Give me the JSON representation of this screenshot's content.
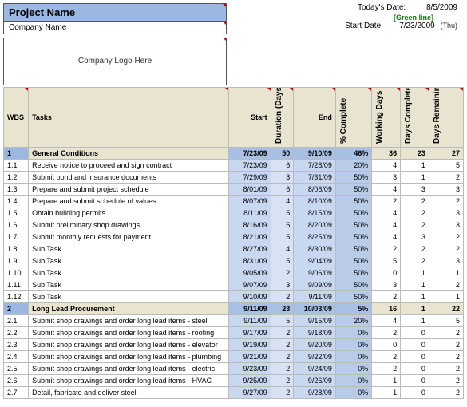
{
  "header": {
    "project_name": "Project Name",
    "company_name": "Company Name",
    "logo_placeholder": "Company Logo Here",
    "todays_date_label": "Today's Date:",
    "todays_date": "8/5/2009",
    "green_line": "[Green line]",
    "start_date_label": "Start Date:",
    "start_date": "7/23/2009",
    "start_day": "(Thu)"
  },
  "columns": {
    "wbs": "WBS",
    "tasks": "Tasks",
    "start": "Start",
    "duration": "Duration (Days)",
    "end": "End",
    "pct": "% Complete",
    "working": "Working Days",
    "days_complete": "Days Complete",
    "days_remaining": "Days Remaining"
  },
  "rows": [
    {
      "wbs": "1",
      "task": "General Conditions",
      "start": "7/23/09",
      "dur": "50",
      "end": "9/10/09",
      "pct": "46%",
      "wd": "36",
      "dc": "23",
      "dr": "27",
      "section": true
    },
    {
      "wbs": "1.1",
      "task": "Receive notice to proceed and sign contract",
      "start": "7/23/09",
      "dur": "6",
      "end": "7/28/09",
      "pct": "20%",
      "wd": "4",
      "dc": "1",
      "dr": "5"
    },
    {
      "wbs": "1.2",
      "task": "Submit bond and insurance documents",
      "start": "7/29/09",
      "dur": "3",
      "end": "7/31/09",
      "pct": "50%",
      "wd": "3",
      "dc": "1",
      "dr": "2"
    },
    {
      "wbs": "1.3",
      "task": "Prepare and submit project schedule",
      "start": "8/01/09",
      "dur": "6",
      "end": "8/06/09",
      "pct": "50%",
      "wd": "4",
      "dc": "3",
      "dr": "3"
    },
    {
      "wbs": "1.4",
      "task": "Prepare and submit schedule of values",
      "start": "8/07/09",
      "dur": "4",
      "end": "8/10/09",
      "pct": "50%",
      "wd": "2",
      "dc": "2",
      "dr": "2"
    },
    {
      "wbs": "1.5",
      "task": "Obtain building permits",
      "start": "8/11/09",
      "dur": "5",
      "end": "8/15/09",
      "pct": "50%",
      "wd": "4",
      "dc": "2",
      "dr": "3"
    },
    {
      "wbs": "1.6",
      "task": "Submit preliminary shop drawings",
      "start": "8/16/09",
      "dur": "5",
      "end": "8/20/09",
      "pct": "50%",
      "wd": "4",
      "dc": "2",
      "dr": "3"
    },
    {
      "wbs": "1.7",
      "task": "Submit monthly requests for payment",
      "start": "8/21/09",
      "dur": "5",
      "end": "8/25/09",
      "pct": "50%",
      "wd": "4",
      "dc": "3",
      "dr": "2"
    },
    {
      "wbs": "1.8",
      "task": "Sub Task",
      "start": "8/27/09",
      "dur": "4",
      "end": "8/30/09",
      "pct": "50%",
      "wd": "2",
      "dc": "2",
      "dr": "2"
    },
    {
      "wbs": "1.9",
      "task": "Sub Task",
      "start": "8/31/09",
      "dur": "5",
      "end": "9/04/09",
      "pct": "50%",
      "wd": "5",
      "dc": "2",
      "dr": "3"
    },
    {
      "wbs": "1.10",
      "task": "Sub Task",
      "start": "9/05/09",
      "dur": "2",
      "end": "9/06/09",
      "pct": "50%",
      "wd": "0",
      "dc": "1",
      "dr": "1"
    },
    {
      "wbs": "1.11",
      "task": "Sub Task",
      "start": "9/07/09",
      "dur": "3",
      "end": "9/09/09",
      "pct": "50%",
      "wd": "3",
      "dc": "1",
      "dr": "2"
    },
    {
      "wbs": "1.12",
      "task": "Sub Task",
      "start": "9/10/09",
      "dur": "2",
      "end": "9/11/09",
      "pct": "50%",
      "wd": "2",
      "dc": "1",
      "dr": "1"
    },
    {
      "wbs": "2",
      "task": "Long Lead Procurement",
      "start": "9/11/09",
      "dur": "23",
      "end": "10/03/09",
      "pct": "5%",
      "wd": "16",
      "dc": "1",
      "dr": "22",
      "section": true
    },
    {
      "wbs": "2.1",
      "task": "Submit shop drawings and order long lead items - steel",
      "start": "9/11/09",
      "dur": "5",
      "end": "9/15/09",
      "pct": "20%",
      "wd": "4",
      "dc": "1",
      "dr": "5"
    },
    {
      "wbs": "2.2",
      "task": "Submit shop drawings and order long lead items - roofing",
      "start": "9/17/09",
      "dur": "2",
      "end": "9/18/09",
      "pct": "0%",
      "wd": "2",
      "dc": "0",
      "dr": "2"
    },
    {
      "wbs": "2.3",
      "task": "Submit shop drawings and order long lead items - elevator",
      "start": "9/19/09",
      "dur": "2",
      "end": "9/20/09",
      "pct": "0%",
      "wd": "0",
      "dc": "0",
      "dr": "2"
    },
    {
      "wbs": "2.4",
      "task": "Submit shop drawings and order long lead items - plumbing",
      "start": "9/21/09",
      "dur": "2",
      "end": "9/22/09",
      "pct": "0%",
      "wd": "2",
      "dc": "0",
      "dr": "2"
    },
    {
      "wbs": "2.5",
      "task": "Submit shop drawings and order long lead items - electric",
      "start": "9/23/09",
      "dur": "2",
      "end": "9/24/09",
      "pct": "0%",
      "wd": "2",
      "dc": "0",
      "dr": "2"
    },
    {
      "wbs": "2.6",
      "task": "Submit shop drawings and order long lead items - HVAC",
      "start": "9/25/09",
      "dur": "2",
      "end": "9/26/09",
      "pct": "0%",
      "wd": "1",
      "dc": "0",
      "dr": "2"
    },
    {
      "wbs": "2.7",
      "task": "Detail, fabricate and deliver steel",
      "start": "9/27/09",
      "dur": "2",
      "end": "9/28/09",
      "pct": "0%",
      "wd": "1",
      "dc": "0",
      "dr": "2"
    }
  ]
}
